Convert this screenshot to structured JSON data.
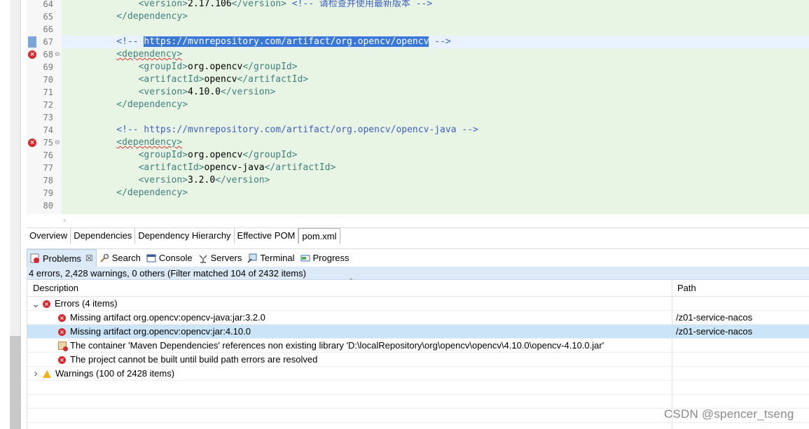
{
  "editor": {
    "lines": [
      {
        "num": "64",
        "indent": "            ",
        "segments": [
          {
            "c": "tag",
            "t": "<version>"
          },
          {
            "c": "txt",
            "t": "2.17.106"
          },
          {
            "c": "tag",
            "t": "</version>"
          },
          {
            "c": "txt",
            "t": " "
          },
          {
            "c": "comment",
            "t": "<!-- 请检查并使用最新版本 -->"
          }
        ]
      },
      {
        "num": "65",
        "indent": "        ",
        "segments": [
          {
            "c": "tag",
            "t": "</dependency>"
          }
        ]
      },
      {
        "num": "66",
        "indent": "",
        "segments": []
      },
      {
        "num": "67",
        "indent": "        ",
        "segments": [
          {
            "c": "comment",
            "t": "<!-- "
          },
          {
            "c": "sel",
            "t": "https://mvnrepository.com/artifact/org.opencv/opencv"
          },
          {
            "c": "comment",
            "t": " -->"
          }
        ]
      },
      {
        "num": "68",
        "indent": "        ",
        "segments": [
          {
            "c": "tag squiggle",
            "t": "<dependency>"
          }
        ]
      },
      {
        "num": "69",
        "indent": "            ",
        "segments": [
          {
            "c": "tag",
            "t": "<groupId>"
          },
          {
            "c": "txt",
            "t": "org.opencv"
          },
          {
            "c": "tag",
            "t": "</groupId>"
          }
        ]
      },
      {
        "num": "70",
        "indent": "            ",
        "segments": [
          {
            "c": "tag",
            "t": "<artifactId>"
          },
          {
            "c": "txt",
            "t": "opencv"
          },
          {
            "c": "tag",
            "t": "</artifactId>"
          }
        ]
      },
      {
        "num": "71",
        "indent": "            ",
        "segments": [
          {
            "c": "tag",
            "t": "<version>"
          },
          {
            "c": "txt",
            "t": "4.10.0"
          },
          {
            "c": "tag",
            "t": "</version>"
          }
        ]
      },
      {
        "num": "72",
        "indent": "        ",
        "segments": [
          {
            "c": "tag",
            "t": "</dependency>"
          }
        ]
      },
      {
        "num": "73",
        "indent": "",
        "segments": []
      },
      {
        "num": "74",
        "indent": "        ",
        "segments": [
          {
            "c": "comment",
            "t": "<!-- https://mvnrepository.com/artifact/org.opencv/opencv-java -->"
          }
        ]
      },
      {
        "num": "75",
        "indent": "        ",
        "segments": [
          {
            "c": "tag squiggle",
            "t": "<dependency>"
          }
        ]
      },
      {
        "num": "76",
        "indent": "            ",
        "segments": [
          {
            "c": "tag",
            "t": "<groupId>"
          },
          {
            "c": "txt",
            "t": "org.opencv"
          },
          {
            "c": "tag",
            "t": "</groupId>"
          }
        ]
      },
      {
        "num": "77",
        "indent": "            ",
        "segments": [
          {
            "c": "tag",
            "t": "<artifactId>"
          },
          {
            "c": "txt",
            "t": "opencv-java"
          },
          {
            "c": "tag",
            "t": "</artifactId>"
          }
        ]
      },
      {
        "num": "78",
        "indent": "            ",
        "segments": [
          {
            "c": "tag",
            "t": "<version>"
          },
          {
            "c": "txt",
            "t": "3.2.0"
          },
          {
            "c": "tag",
            "t": "</version>"
          }
        ]
      },
      {
        "num": "79",
        "indent": "        ",
        "segments": [
          {
            "c": "tag",
            "t": "</dependency>"
          }
        ]
      },
      {
        "num": "80",
        "indent": "",
        "segments": []
      }
    ],
    "error_lines": [
      "68",
      "75"
    ],
    "current_line": "67",
    "fold_lines": [
      "68",
      "75"
    ]
  },
  "editor_tabs": [
    "Overview",
    "Dependencies",
    "Dependency Hierarchy",
    "Effective POM",
    "pom.xml"
  ],
  "editor_tab_active": "pom.xml",
  "view_tabs": [
    {
      "label": "Problems",
      "icon": "problems-icon",
      "active": true,
      "closable": true
    },
    {
      "label": "Search",
      "icon": "search-icon",
      "active": false
    },
    {
      "label": "Console",
      "icon": "console-icon",
      "active": false
    },
    {
      "label": "Servers",
      "icon": "servers-icon",
      "active": false
    },
    {
      "label": "Terminal",
      "icon": "terminal-icon",
      "active": false
    },
    {
      "label": "Progress",
      "icon": "progress-icon",
      "active": false
    }
  ],
  "problems": {
    "summary": "4 errors, 2,428 warnings, 0 others (Filter matched 104 of 2432 items)",
    "columns": {
      "description": "Description",
      "path": "Path"
    },
    "rows": [
      {
        "level": 0,
        "expander": "expanded",
        "icon": "error-icon",
        "description": "Errors (4 items)",
        "path": ""
      },
      {
        "level": 1,
        "expander": "",
        "icon": "error-icon",
        "description": "Missing artifact org.opencv:opencv-java:jar:3.2.0",
        "path": "/z01-service-nacos"
      },
      {
        "level": 1,
        "expander": "",
        "icon": "error-icon",
        "description": "Missing artifact org.opencv:opencv:jar:4.10.0",
        "path": "/z01-service-nacos",
        "selected": true
      },
      {
        "level": 1,
        "expander": "",
        "icon": "library-error-icon",
        "description": "The container 'Maven Dependencies' references non existing library 'D:\\localRepository\\org\\opencv\\opencv\\4.10.0\\opencv-4.10.0.jar'",
        "path": ""
      },
      {
        "level": 1,
        "expander": "",
        "icon": "error-icon",
        "description": "The project cannot be built until build path errors are resolved",
        "path": ""
      },
      {
        "level": 0,
        "expander": "collapsed",
        "icon": "warning-icon",
        "description": "Warnings (100 of 2428 items)",
        "path": ""
      }
    ]
  },
  "watermark": "CSDN @spencer_tseng"
}
